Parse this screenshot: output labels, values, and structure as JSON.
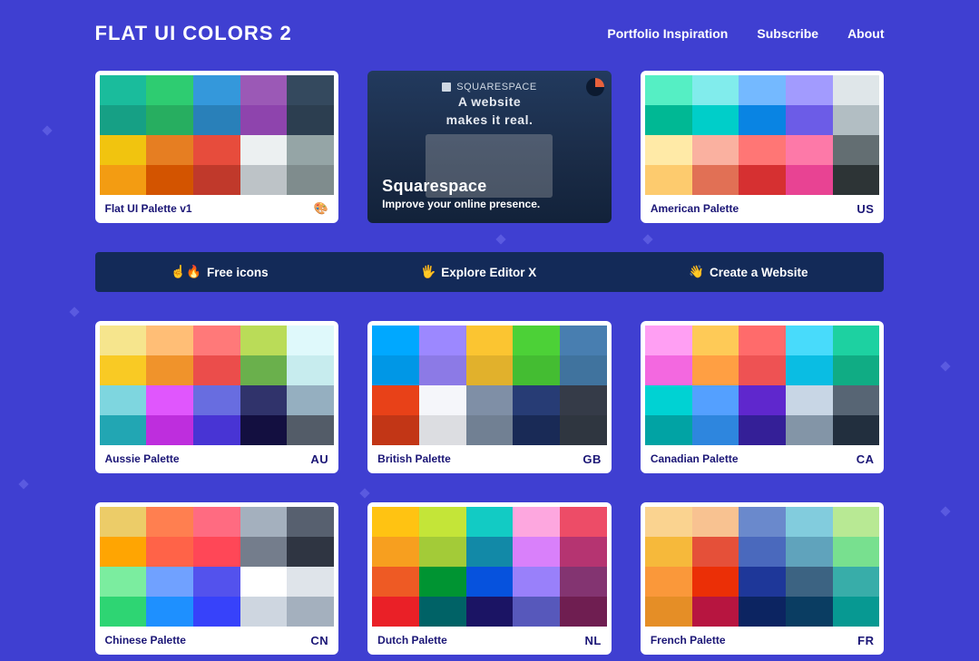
{
  "header": {
    "title": "FLAT UI COLORS 2",
    "nav": [
      "Portfolio Inspiration",
      "Subscribe",
      "About"
    ]
  },
  "ad": {
    "brand": "SQUARESPACE",
    "tagline1": "A website",
    "tagline2": "makes it real.",
    "title": "Squarespace",
    "subtitle": "Improve your online presence."
  },
  "promos": [
    {
      "emoji": "☝️🔥",
      "label": "Free icons"
    },
    {
      "emoji": "🖐️",
      "label": "Explore Editor X"
    },
    {
      "emoji": "👋",
      "label": "Create a Website"
    }
  ],
  "palettes": [
    {
      "name": "Flat UI Palette v1",
      "code": "🎨",
      "colors": [
        "#1abc9c",
        "#2ecc71",
        "#3498db",
        "#9b59b6",
        "#34495e",
        "#16a085",
        "#27ae60",
        "#2980b9",
        "#8e44ad",
        "#2c3e50",
        "#f1c40f",
        "#e67e22",
        "#e74c3c",
        "#ecf0f1",
        "#95a5a6",
        "#f39c12",
        "#d35400",
        "#c0392b",
        "#bdc3c7",
        "#7f8c8d"
      ]
    },
    {
      "name": "American Palette",
      "code": "US",
      "colors": [
        "#55efc4",
        "#81ecec",
        "#74b9ff",
        "#a29bfe",
        "#dfe6e9",
        "#00b894",
        "#00cec9",
        "#0984e3",
        "#6c5ce7",
        "#b2bec3",
        "#ffeaa7",
        "#fab1a0",
        "#ff7675",
        "#fd79a8",
        "#636e72",
        "#fdcb6e",
        "#e17055",
        "#d63031",
        "#e84393",
        "#2d3436"
      ]
    },
    {
      "name": "Aussie Palette",
      "code": "AU",
      "colors": [
        "#f6e58d",
        "#ffbe76",
        "#ff7979",
        "#badc58",
        "#dff9fb",
        "#f9ca24",
        "#f0932b",
        "#eb4d4b",
        "#6ab04c",
        "#c7ecee",
        "#7ed6df",
        "#e056fd",
        "#686de0",
        "#30336b",
        "#95afc0",
        "#22a6b3",
        "#be2edd",
        "#4834d4",
        "#130f40",
        "#535c68"
      ]
    },
    {
      "name": "British Palette",
      "code": "GB",
      "colors": [
        "#00a8ff",
        "#9c88ff",
        "#fbc531",
        "#4cd137",
        "#487eb0",
        "#0097e6",
        "#8c7ae6",
        "#e1b12c",
        "#44bd32",
        "#40739e",
        "#e84118",
        "#f5f6fa",
        "#7f8fa6",
        "#273c75",
        "#353b48",
        "#c23616",
        "#dcdde1",
        "#718093",
        "#192a56",
        "#2f3640"
      ]
    },
    {
      "name": "Canadian Palette",
      "code": "CA",
      "colors": [
        "#ff9ff3",
        "#feca57",
        "#ff6b6b",
        "#48dbfb",
        "#1dd1a1",
        "#f368e0",
        "#ff9f43",
        "#ee5253",
        "#0abde3",
        "#10ac84",
        "#00d2d3",
        "#54a0ff",
        "#5f27cd",
        "#c8d6e5",
        "#576574",
        "#01a3a4",
        "#2e86de",
        "#341f97",
        "#8395a7",
        "#222f3e"
      ]
    },
    {
      "name": "Chinese Palette",
      "code": "CN",
      "colors": [
        "#eccc68",
        "#ff7f50",
        "#ff6b81",
        "#a4b0be",
        "#57606f",
        "#ffa502",
        "#ff6348",
        "#ff4757",
        "#747d8c",
        "#2f3542",
        "#7bed9f",
        "#70a1ff",
        "#5352ed",
        "#ffffff",
        "#dfe4ea",
        "#2ed573",
        "#1e90ff",
        "#3742fa",
        "#ced6e0",
        "#a4b0be"
      ]
    },
    {
      "name": "Dutch Palette",
      "code": "NL",
      "colors": [
        "#ffc312",
        "#c4e538",
        "#12cbc4",
        "#fda7df",
        "#ed4c67",
        "#f79f1f",
        "#a3cb38",
        "#1289a7",
        "#d980fa",
        "#b53471",
        "#ee5a24",
        "#009432",
        "#0652dd",
        "#9980fa",
        "#833471",
        "#ea2027",
        "#006266",
        "#1b1464",
        "#5758bb",
        "#6f1e51"
      ]
    },
    {
      "name": "French Palette",
      "code": "FR",
      "colors": [
        "#fad390",
        "#f8c291",
        "#6a89cc",
        "#82ccdd",
        "#b8e994",
        "#f6b93b",
        "#e55039",
        "#4a69bd",
        "#60a3bc",
        "#78e08f",
        "#fa983a",
        "#eb2f06",
        "#1e3799",
        "#3c6382",
        "#38ada9",
        "#e58e26",
        "#b71540",
        "#0c2461",
        "#0a3d62",
        "#079992"
      ]
    }
  ]
}
